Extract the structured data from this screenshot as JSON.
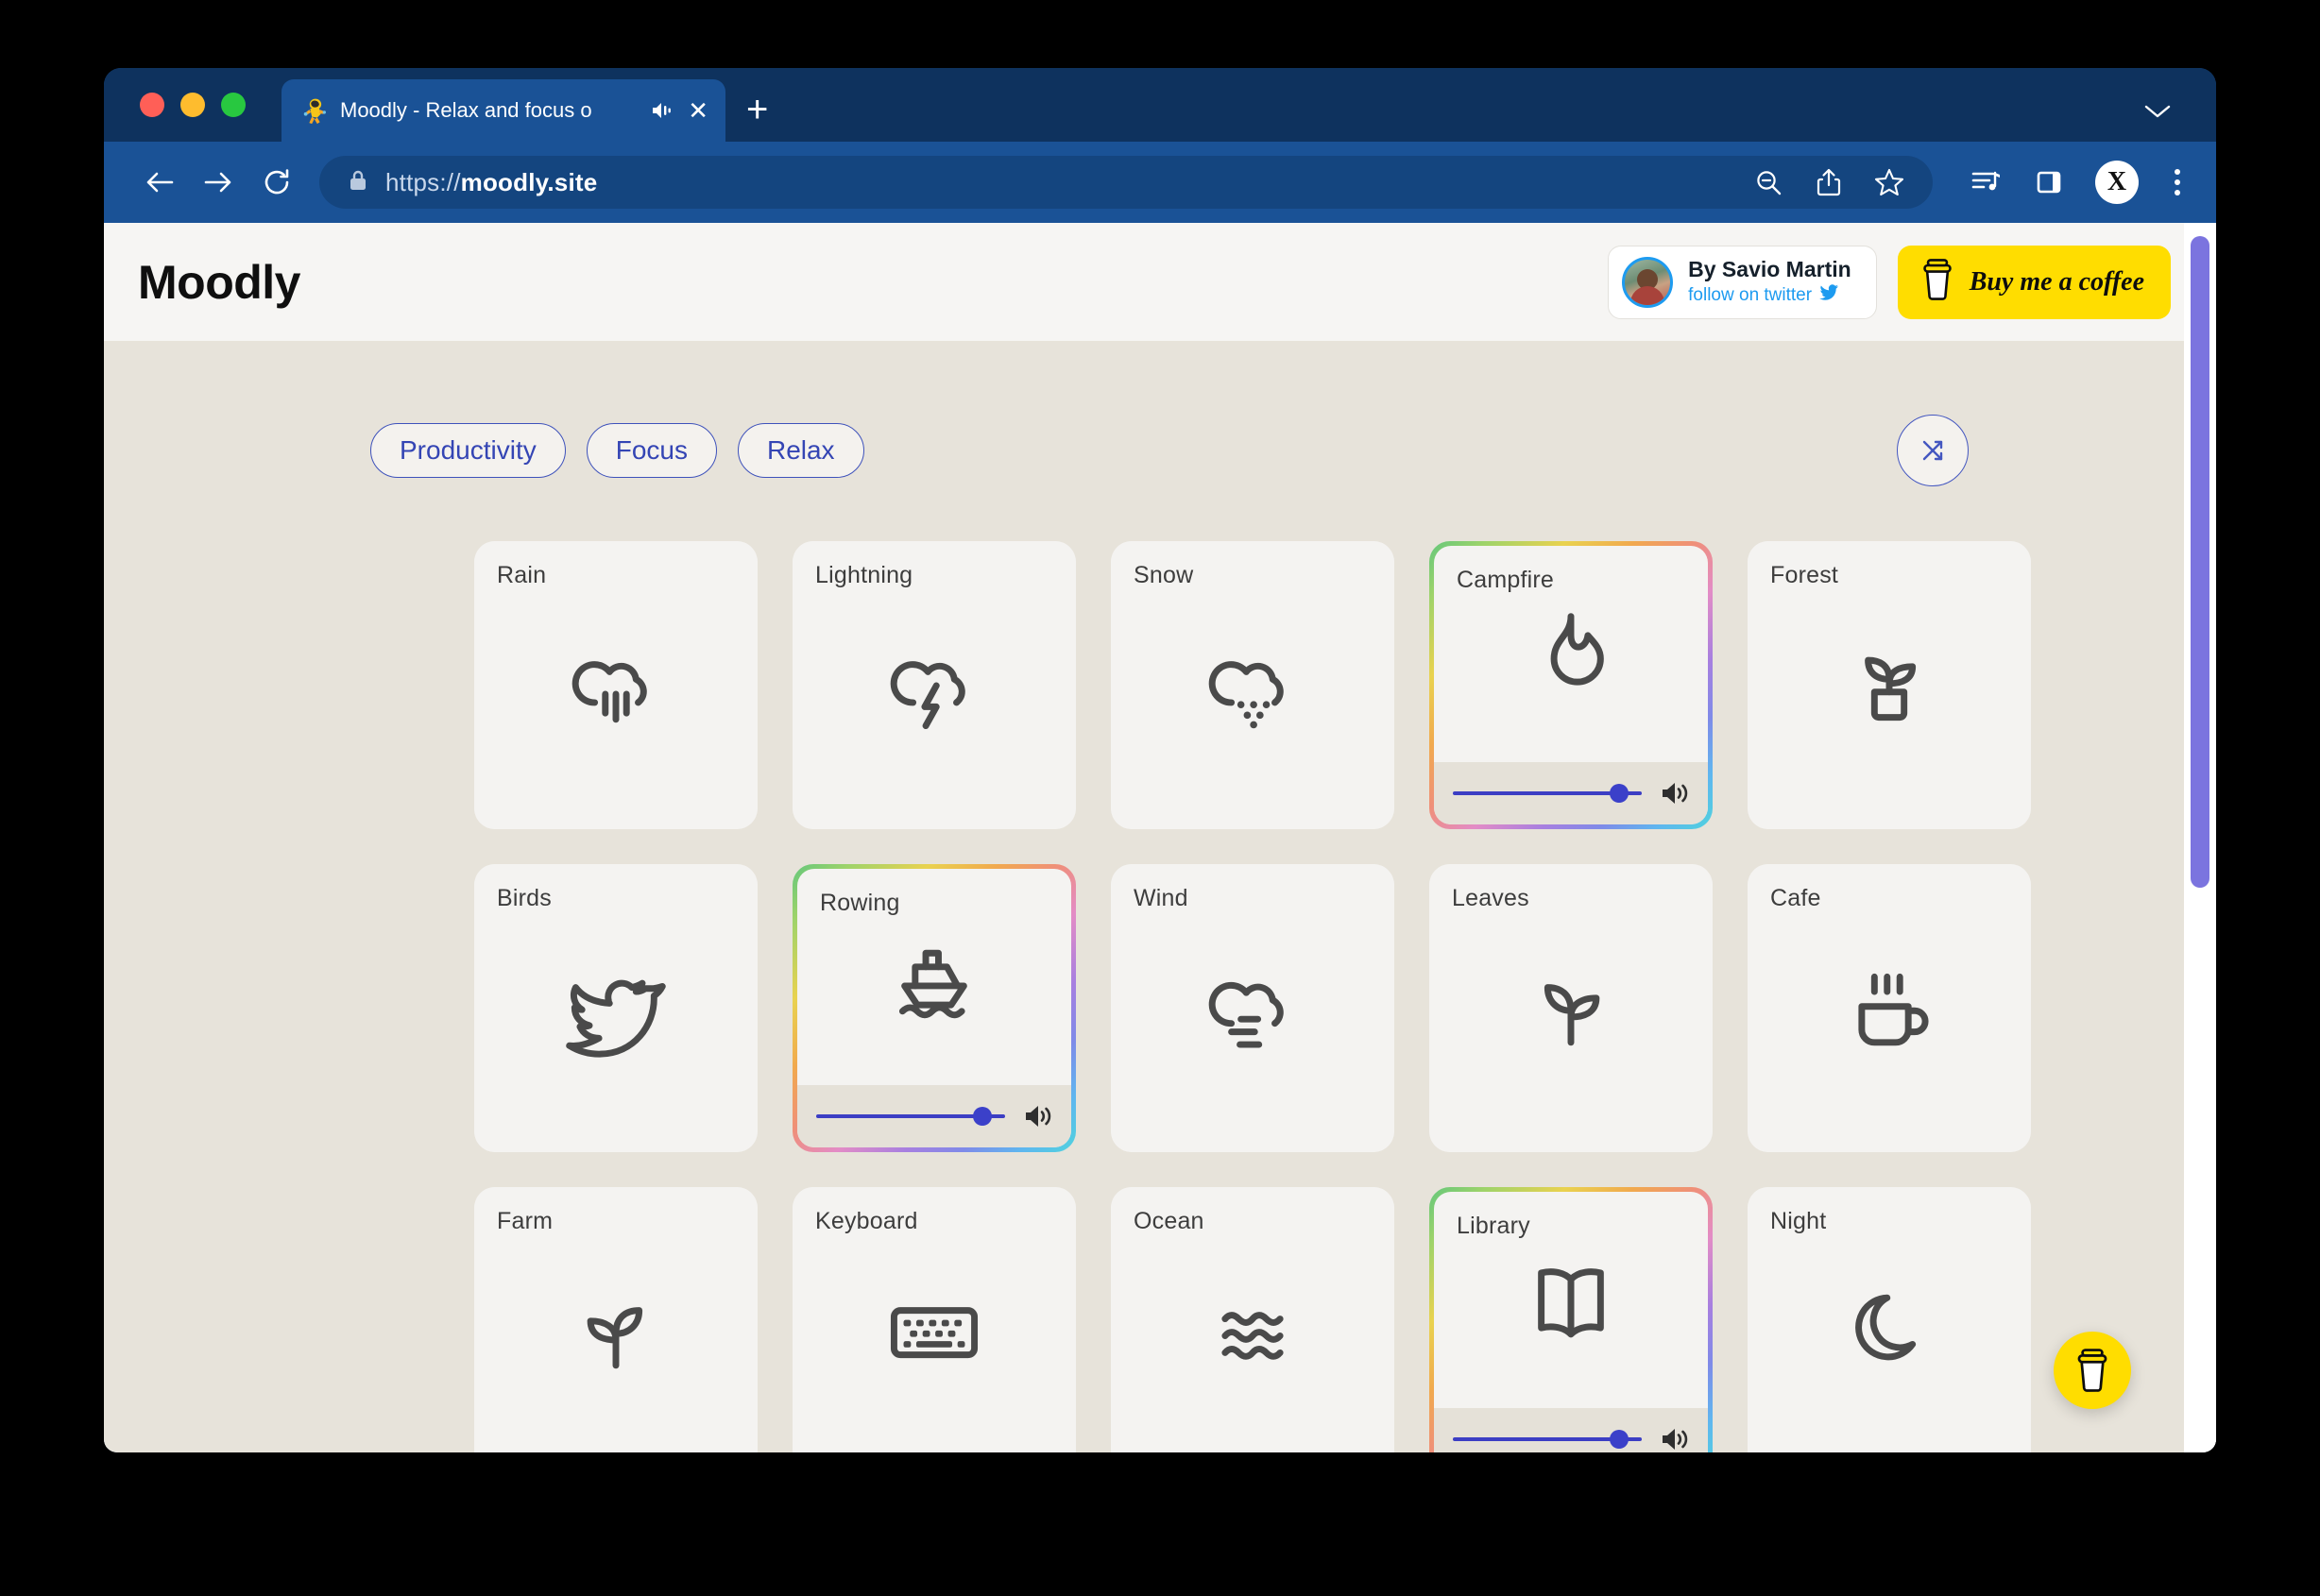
{
  "browser": {
    "tab": {
      "favicon": "astronaut-icon",
      "title": "Moodly - Relax and focus o",
      "audio_icon": "speaker-playing-icon",
      "close_label": "✕"
    },
    "new_tab_label": "+",
    "window_chevron": "chevron-down-icon",
    "toolbar": {
      "back": "back-arrow-icon",
      "forward": "forward-arrow-icon",
      "reload": "reload-icon",
      "lock": "lock-icon",
      "url_prefix": "https://",
      "url_domain": "moodly.site",
      "actions": [
        "zoom-out-icon",
        "share-icon",
        "bookmark-star-icon"
      ],
      "right_actions": [
        "music-playlist-icon",
        "sidebar-panel-icon"
      ],
      "profile_initial": "X",
      "menu": "three-dot-menu-icon"
    }
  },
  "site": {
    "logo": "Moodly",
    "author": {
      "name": "By Savio Martin",
      "follow": "follow on twitter",
      "twitter_icon": "twitter-bird-icon",
      "avatar": "author-avatar"
    },
    "bmc": {
      "label": "Buy me a coffee",
      "icon": "coffee-cup-icon",
      "color": "#ffdd00"
    },
    "fab": {
      "icon": "coffee-cup-icon",
      "color": "#ffdd00"
    }
  },
  "controls": {
    "categories": [
      "Productivity",
      "Focus",
      "Relax"
    ],
    "shuffle_icon": "shuffle-icon",
    "accent_color": "#3445b4"
  },
  "grid": {
    "cards": [
      {
        "label": "Rain",
        "icon": "cloud-rain-icon",
        "active": false,
        "volume": null
      },
      {
        "label": "Lightning",
        "icon": "cloud-lightning-icon",
        "active": false,
        "volume": null
      },
      {
        "label": "Snow",
        "icon": "cloud-snow-icon",
        "active": false,
        "volume": null
      },
      {
        "label": "Campfire",
        "icon": "flame-icon",
        "active": true,
        "volume": 88
      },
      {
        "label": "Forest",
        "icon": "potted-plant-icon",
        "active": false,
        "volume": null
      },
      {
        "label": "Birds",
        "icon": "bird-icon",
        "active": false,
        "volume": null
      },
      {
        "label": "Rowing",
        "icon": "boat-icon",
        "active": true,
        "volume": 88
      },
      {
        "label": "Wind",
        "icon": "cloud-wind-icon",
        "active": false,
        "volume": null
      },
      {
        "label": "Leaves",
        "icon": "sprout-icon",
        "active": false,
        "volume": null
      },
      {
        "label": "Cafe",
        "icon": "coffee-mug-icon",
        "active": false,
        "volume": null
      },
      {
        "label": "Farm",
        "icon": "sprout-icon",
        "active": false,
        "volume": null
      },
      {
        "label": "Keyboard",
        "icon": "keyboard-icon",
        "active": false,
        "volume": null
      },
      {
        "label": "Ocean",
        "icon": "waves-icon",
        "active": false,
        "volume": null
      },
      {
        "label": "Library",
        "icon": "open-book-icon",
        "active": true,
        "volume": 88
      },
      {
        "label": "Night",
        "icon": "crescent-moon-icon",
        "active": false,
        "volume": null
      }
    ],
    "volume_icon": "speaker-volume-icon",
    "slider_color": "#3b40c9",
    "active_border": "rainbow-gradient"
  },
  "scrollbar": {
    "thumb_color": "#7b74df"
  }
}
